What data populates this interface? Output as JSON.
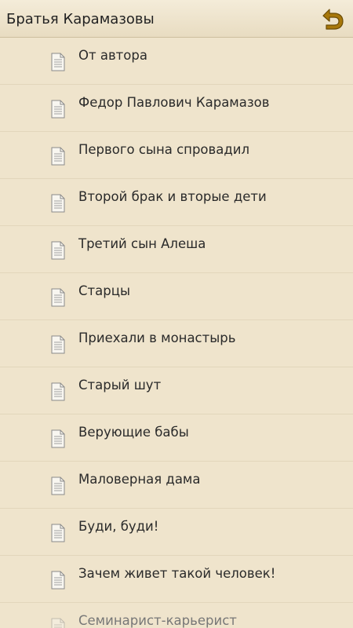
{
  "window": {
    "title": "Братья Карамазовы"
  },
  "icons": {
    "back": "back-arrow-icon",
    "chapter": "document-icon"
  },
  "colors": {
    "background": "#efe4cc",
    "accent": "#a7770a",
    "text": "#2a2a2a"
  },
  "chapters": [
    {
      "label": "От автора"
    },
    {
      "label": "Федор Павлович Карамазов"
    },
    {
      "label": "Первого сына спровадил"
    },
    {
      "label": "Второй брак и вторые дети"
    },
    {
      "label": "Третий сын Алеша"
    },
    {
      "label": "Старцы"
    },
    {
      "label": "Приехали в монастырь"
    },
    {
      "label": "Старый шут"
    },
    {
      "label": "Верующие бабы"
    },
    {
      "label": "Маловерная дама"
    },
    {
      "label": "Буди, буди!"
    },
    {
      "label": "Зачем живет такой человек!"
    },
    {
      "label": "Семинарист-карьерист"
    }
  ]
}
